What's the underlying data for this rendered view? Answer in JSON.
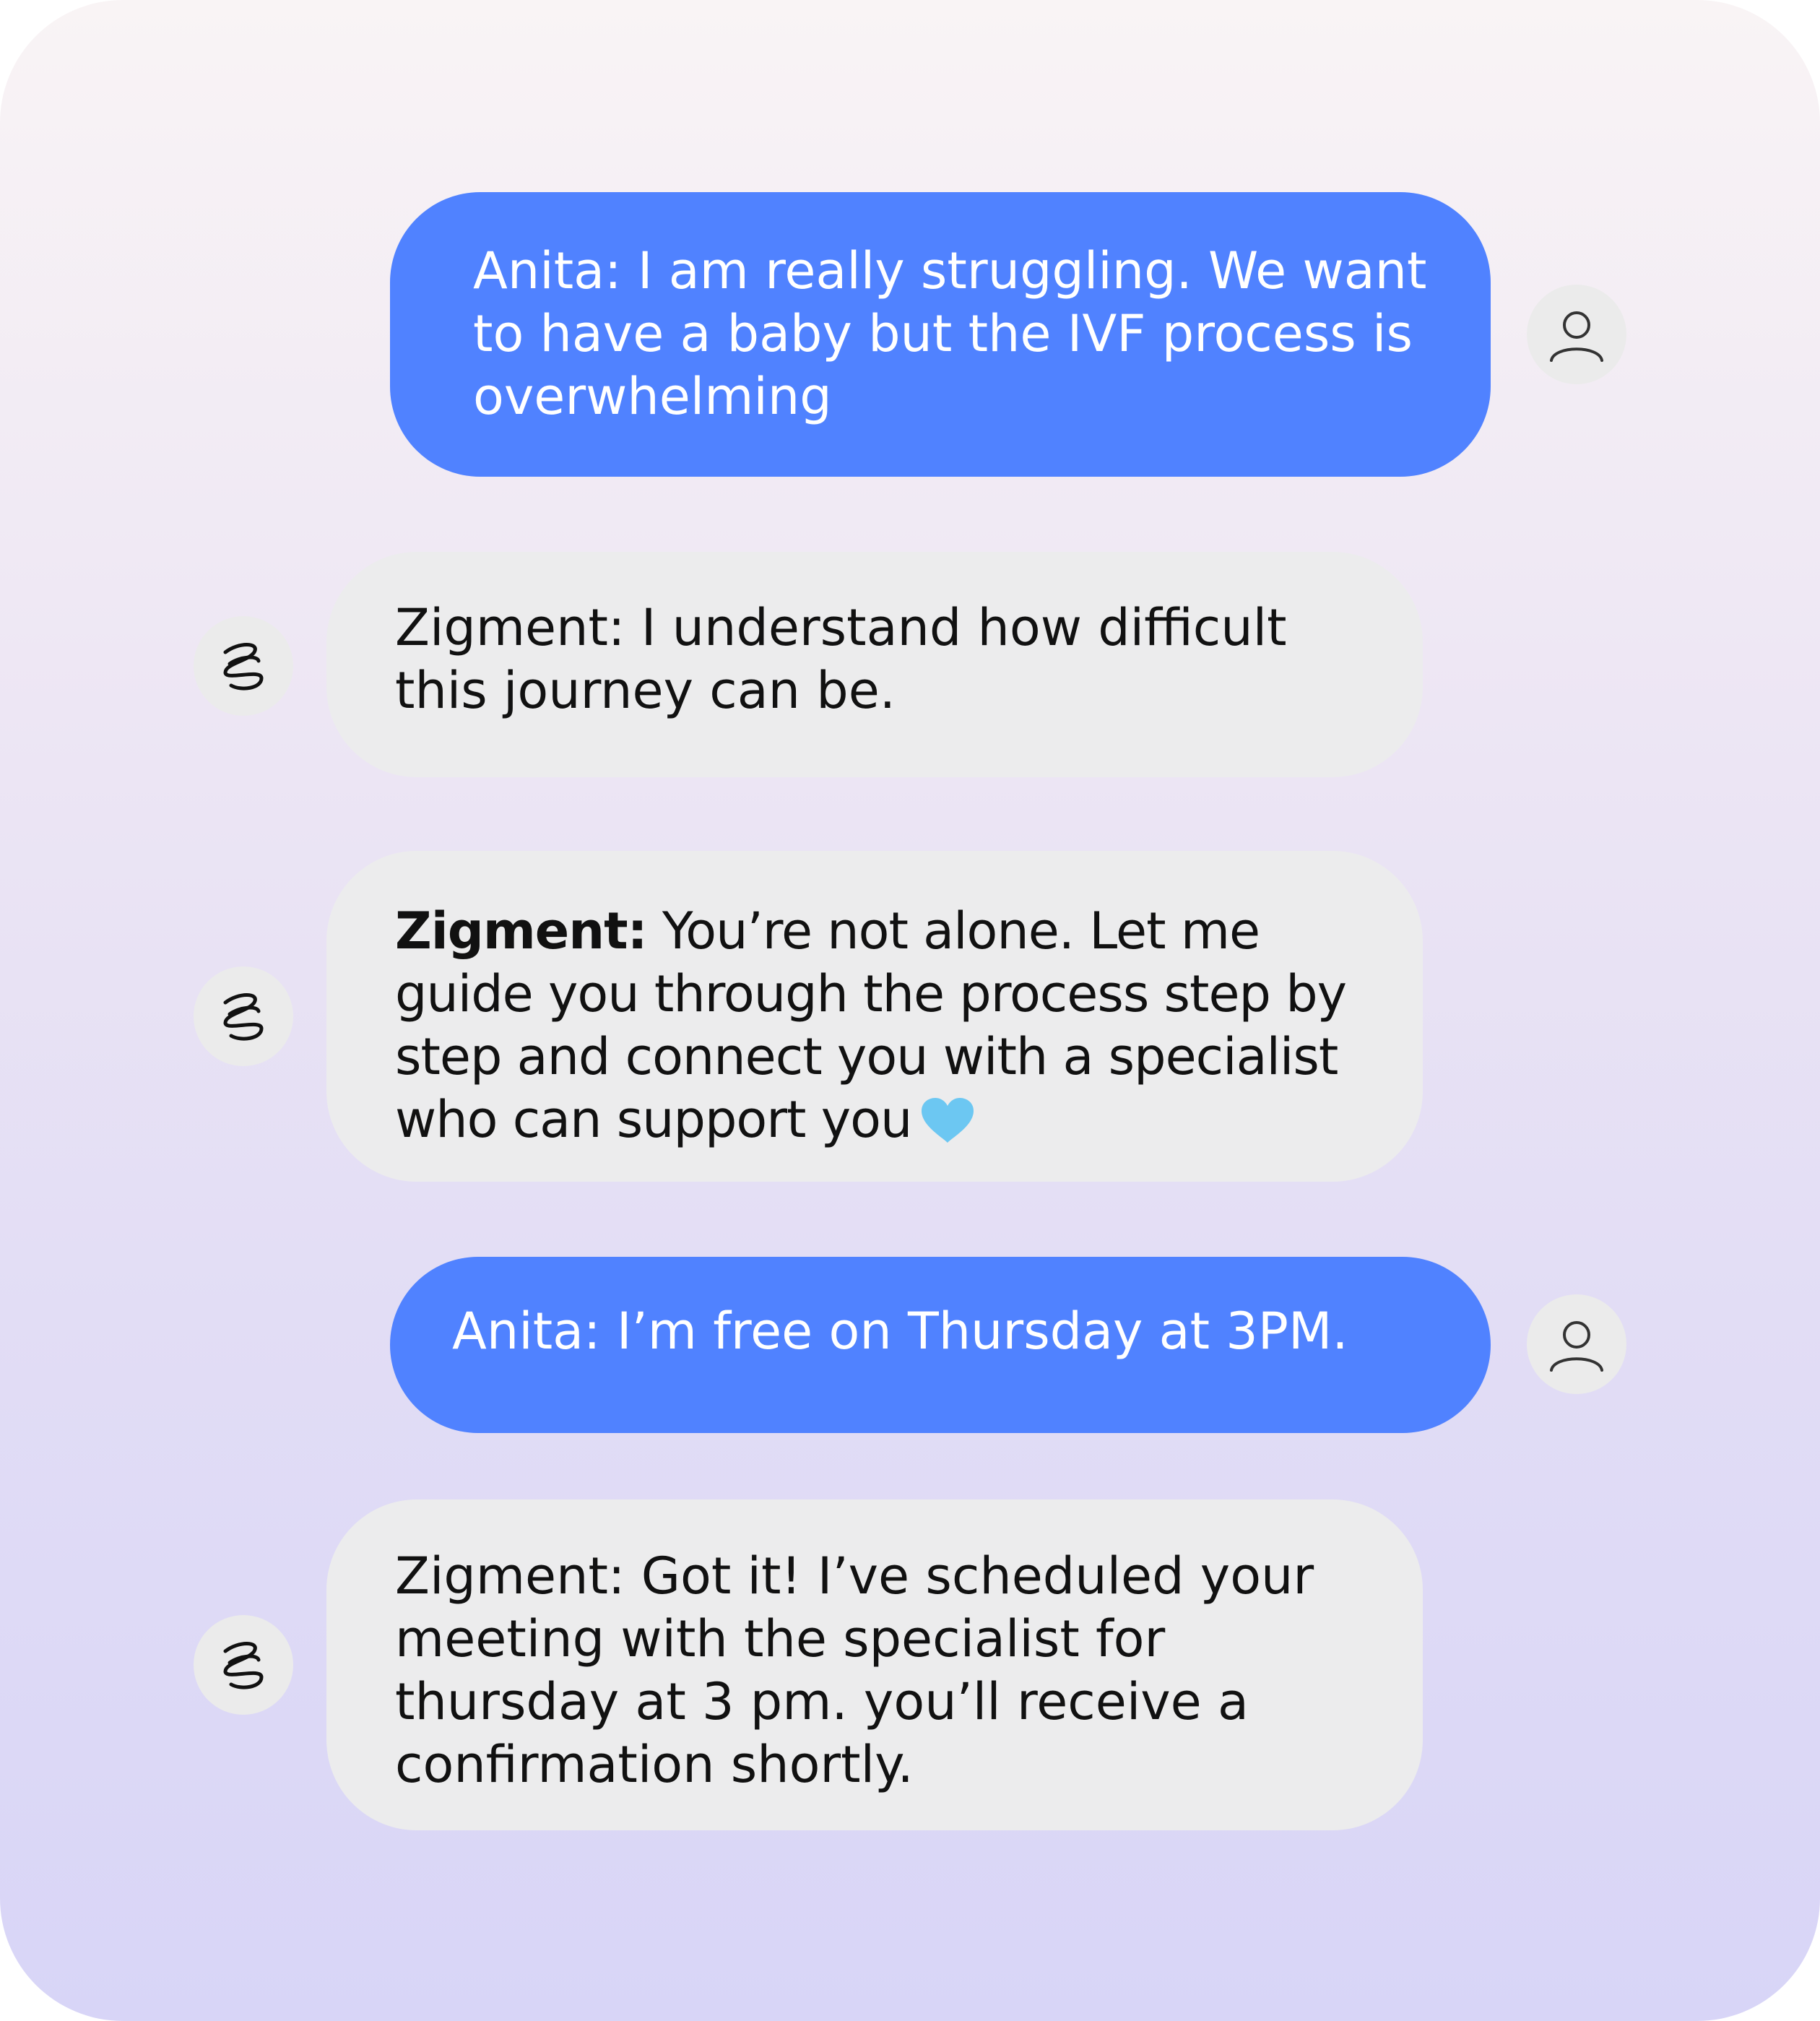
{
  "messages": [
    {
      "role": "user",
      "speaker": "Anita:",
      "text": "I am really struggling. We want to have a baby but the IVF process is overwhelming",
      "avatar_icon": "user-icon"
    },
    {
      "role": "bot",
      "speaker": "Zigment:",
      "text": "I understand how difficult this journey can be.",
      "avatar_icon": "zigment-logo-icon"
    },
    {
      "role": "bot",
      "speaker": "Zigment:",
      "text": "You’re not alone. Let me guide you through the process step by step and connect you with a specialist who can support you",
      "trailing_icon": "heart-icon",
      "avatar_icon": "zigment-logo-icon"
    },
    {
      "role": "user",
      "speaker": "Anita:",
      "text": "I’m free on Thursday at 3PM.",
      "avatar_icon": "user-icon"
    },
    {
      "role": "bot",
      "speaker": "Zigment:",
      "text": "Got it! I’ve scheduled your meeting with the specialist for thursday at 3 pm. you’ll receive a confirmation shortly.",
      "avatar_icon": "zigment-logo-icon"
    }
  ],
  "colors": {
    "user_bubble": "#5082ff",
    "bot_bubble": "#ececed",
    "avatar_bg": "#ebebeb",
    "heart": "#6cc7f2"
  }
}
